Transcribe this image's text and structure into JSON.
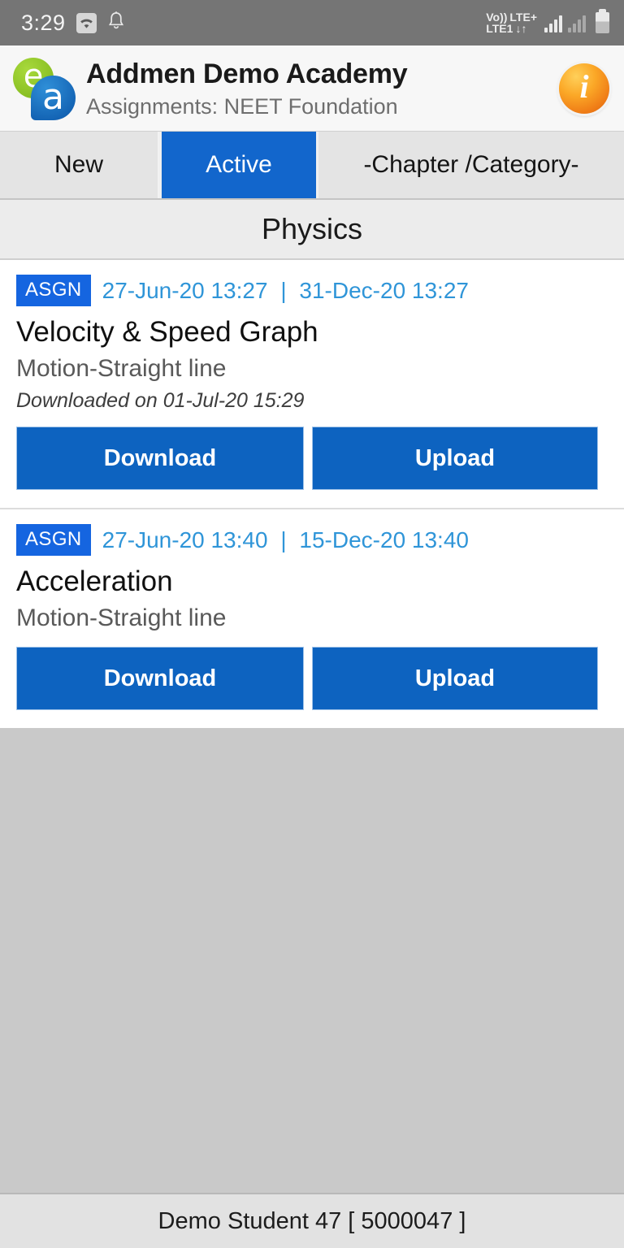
{
  "status_bar": {
    "time": "3:29",
    "wifi_icon": "wifi-icon",
    "notification_icon": "bell-icon",
    "volte_line1": "Vo))",
    "volte_line2": "LTE1",
    "network_label": "LTE+",
    "data_arrows": "↓↑",
    "battery_icon": "battery-icon"
  },
  "header": {
    "logo_e": "e",
    "logo_a": "a",
    "title": "Addmen Demo Academy",
    "subtitle": "Assignments: NEET Foundation",
    "info_glyph": "i",
    "info_icon": "info-icon"
  },
  "tabs": [
    {
      "label": "New",
      "active": false
    },
    {
      "label": "Active",
      "active": true
    },
    {
      "label": "-Chapter /Category-",
      "active": false
    }
  ],
  "subject": {
    "label": "Physics"
  },
  "assignments": [
    {
      "badge": "ASGN",
      "start_date": "27-Jun-20 13:27",
      "separator": "|",
      "end_date": "31-Dec-20 13:27",
      "title": "Velocity & Speed Graph",
      "chapter": "Motion-Straight line",
      "note": "Downloaded on 01-Jul-20 15:29",
      "download_label": "Download",
      "upload_label": "Upload"
    },
    {
      "badge": "ASGN",
      "start_date": "27-Jun-20 13:40",
      "separator": "|",
      "end_date": "15-Dec-20 13:40",
      "title": "Acceleration",
      "chapter": "Motion-Straight line",
      "note": "",
      "download_label": "Download",
      "upload_label": "Upload"
    }
  ],
  "footer": {
    "user": "Demo Student 47 [ 5000047 ]"
  },
  "colors": {
    "accent_blue": "#0d63c0",
    "tab_active": "#1266cc",
    "badge_blue": "#1565e0",
    "date_blue": "#2f95d8",
    "status_gray": "#757575",
    "body_gray": "#c9c9c9"
  }
}
